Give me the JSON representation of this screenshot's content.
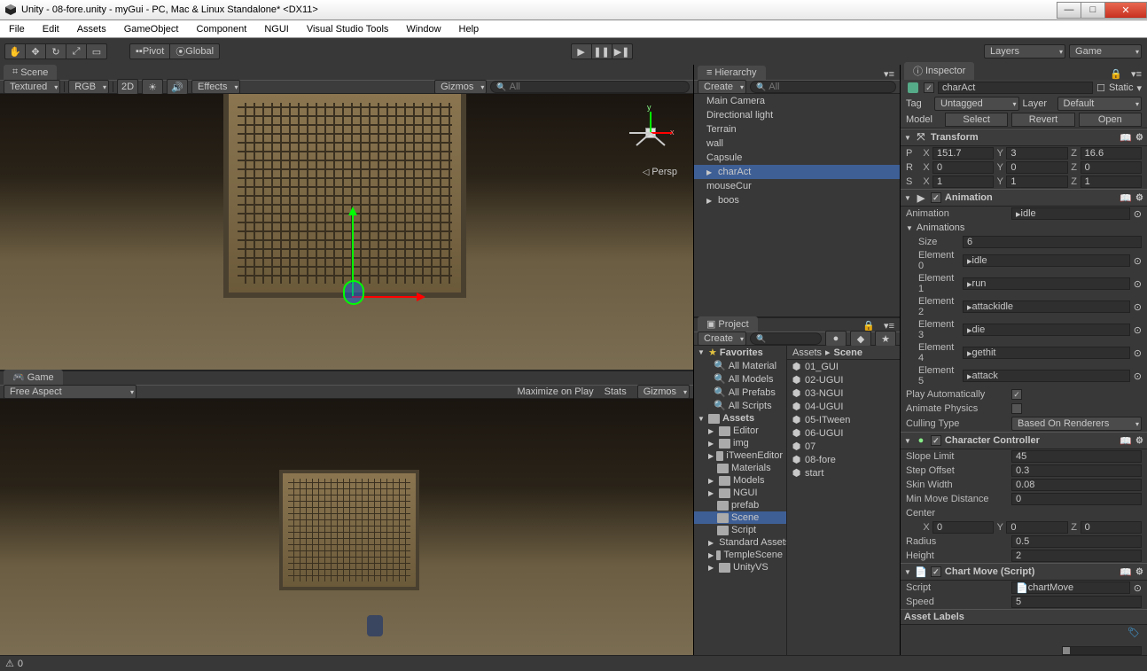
{
  "window": {
    "title": "Unity - 08-fore.unity - myGui - PC, Mac & Linux Standalone* <DX11>"
  },
  "menu": [
    "File",
    "Edit",
    "Assets",
    "GameObject",
    "Component",
    "NGUI",
    "Visual Studio Tools",
    "Window",
    "Help"
  ],
  "toolbar": {
    "pivot": "Pivot",
    "global": "Global",
    "layers": "Layers",
    "layout": "Game"
  },
  "scene": {
    "tab": "Scene",
    "shading": "Textured",
    "rgb": "RGB",
    "twod": "2D",
    "effects": "Effects",
    "gizmos": "Gizmos",
    "search": "All",
    "persp": "Persp",
    "y": "y",
    "x": "x"
  },
  "game": {
    "tab": "Game",
    "aspect": "Free Aspect",
    "maximize": "Maximize on Play",
    "stats": "Stats",
    "gizmos": "Gizmos"
  },
  "hierarchy": {
    "tab": "Hierarchy",
    "create": "Create",
    "search": "All",
    "items": [
      "Main Camera",
      "Directional light",
      "Terrain",
      "wall",
      "Capsule",
      "charAct",
      "mouseCur",
      "boos"
    ]
  },
  "projectPanel": {
    "tab": "Project",
    "create": "Create",
    "favorites": {
      "label": "Favorites",
      "items": [
        "All Material",
        "All Models",
        "All Prefabs",
        "All Scripts"
      ]
    },
    "assetsRoot": "Assets",
    "folders": [
      "Editor",
      "img",
      "iTweenEditor",
      "Materials",
      "Models",
      "NGUI",
      "prefab",
      "Scene",
      "Script",
      "Standard Assets",
      "TempleScene",
      "UnityVS"
    ],
    "breadcrumb": {
      "assets": "Assets",
      "scene": "Scene"
    },
    "scenes": [
      "01_GUI",
      "02-UGUI",
      "03-NGUI",
      "04-UGUI",
      "05-ITween",
      "06-UGUI",
      "07",
      "08-fore",
      "start"
    ]
  },
  "inspector": {
    "tab": "Inspector",
    "name": "charAct",
    "static": "Static",
    "tagL": "Tag",
    "tag": "Untagged",
    "layerL": "Layer",
    "layer": "Default",
    "model": "Model",
    "select": "Select",
    "revert": "Revert",
    "open": "Open",
    "transform": {
      "title": "Transform",
      "P": "P",
      "R": "R",
      "S": "S",
      "px": "151.7",
      "py": "3",
      "pz": "16.6",
      "rx": "0",
      "ry": "0",
      "rz": "0",
      "sx": "1",
      "sy": "1",
      "sz": "1"
    },
    "animation": {
      "title": "Animation",
      "animL": "Animation",
      "anim": "idle",
      "animsL": "Animations",
      "sizeL": "Size",
      "size": "6",
      "el": [
        "Element 0",
        "Element 1",
        "Element 2",
        "Element 3",
        "Element 4",
        "Element 5"
      ],
      "ev": [
        "idle",
        "run",
        "attackidle",
        "die",
        "gethit",
        "attack"
      ],
      "playAutoL": "Play Automatically",
      "animPhysL": "Animate Physics",
      "cullL": "Culling Type",
      "cull": "Based On Renderers"
    },
    "cc": {
      "title": "Character Controller",
      "slopeL": "Slope Limit",
      "slope": "45",
      "stepL": "Step Offset",
      "step": "0.3",
      "skinL": "Skin Width",
      "skin": "0.08",
      "minL": "Min Move Distance",
      "min": "0",
      "centerL": "Center",
      "cx": "0",
      "cy": "0",
      "cz": "0",
      "radiusL": "Radius",
      "radius": "0.5",
      "heightL": "Height",
      "height": "2"
    },
    "script": {
      "title": "Chart Move (Script)",
      "scriptL": "Script",
      "script": "chartMove",
      "speedL": "Speed",
      "speed": "5"
    },
    "assetLabels": "Asset Labels"
  },
  "status": {
    "count": "0"
  }
}
